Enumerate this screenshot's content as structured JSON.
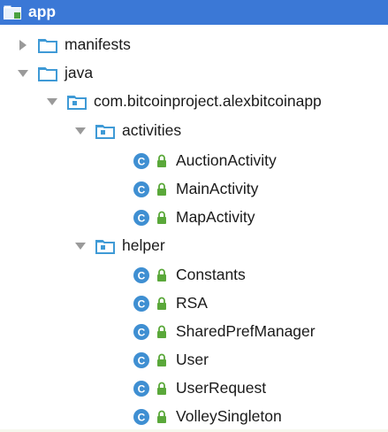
{
  "tree": {
    "root": {
      "label": "app",
      "icon": "module-folder-icon"
    },
    "manifests": {
      "label": "manifests",
      "icon": "folder-icon",
      "state": "collapsed"
    },
    "java": {
      "label": "java",
      "icon": "folder-icon",
      "state": "expanded"
    },
    "package": {
      "label": "com.bitcoinproject.alexbitcoinapp",
      "icon": "package-icon",
      "state": "expanded"
    },
    "activities": {
      "label": "activities",
      "icon": "package-icon",
      "state": "expanded",
      "items": [
        "AuctionActivity",
        "MainActivity",
        "MapActivity"
      ]
    },
    "helper": {
      "label": "helper",
      "icon": "package-icon",
      "state": "expanded",
      "items": [
        "Constants",
        "RSA",
        "SharedPrefManager",
        "User",
        "UserRequest",
        "VolleySingleton"
      ]
    }
  },
  "colors": {
    "selection": "#3b78d6",
    "folder": "#3f9ad6",
    "class_icon": "#3f8fd2",
    "lock_icon": "#5aa83a",
    "arrow": "#9a9a9a"
  }
}
